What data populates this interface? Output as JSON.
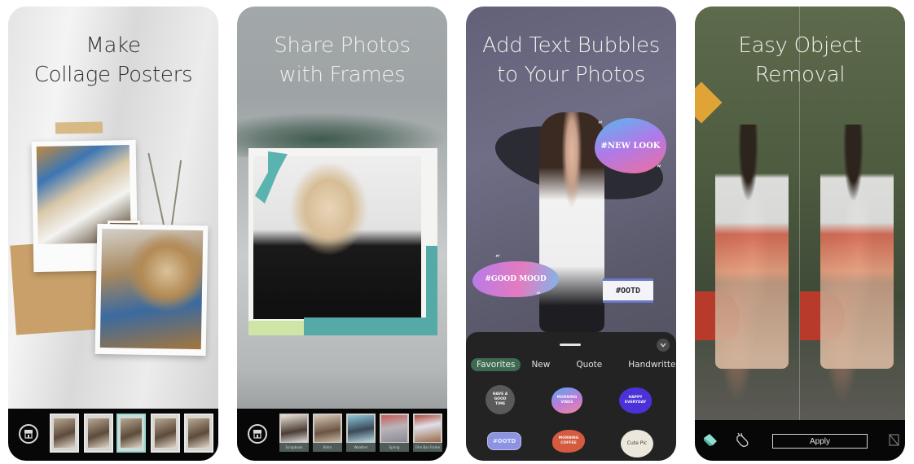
{
  "panels": [
    {
      "id": "collage",
      "headline_line1": "Make",
      "headline_line2": "Collage Posters",
      "thumbnails": [
        "Collage template 1",
        "Collage template 2",
        "Collage template 3",
        "Collage template 4",
        "Collage template 5"
      ],
      "selected_thumbnail_index": 2
    },
    {
      "id": "frames",
      "headline_line1": "Share Photos",
      "headline_line2": "with Frames",
      "frame_labels": [
        "Scrapbook",
        "Retro",
        "Weather",
        "Spring",
        "Film Bar Frame"
      ]
    },
    {
      "id": "text-bubbles",
      "headline_line1": "Add Text Bubbles",
      "headline_line2": "to Your Photos",
      "overlay_bubbles": [
        "#NEW LOOK",
        "#GOOD MOOD",
        "#OOTD"
      ],
      "tabs": [
        "Favorites",
        "New",
        "Quote",
        "Handwritten"
      ],
      "active_tab": "Favorites",
      "stickers": [
        {
          "text": "HAVE A GOOD TIME",
          "color": "#5a5a5a"
        },
        {
          "text": "MORNING VIBES",
          "color": "#b07ad8"
        },
        {
          "text": "HAPPY EVERYDAY",
          "color": "#4a32d8"
        },
        {
          "text": "#OOTD",
          "color": "#8c93e0"
        },
        {
          "text": "MORNING COFFEE",
          "color": "#d65a3e"
        },
        {
          "text": "Cute Pic",
          "color": "#ece7dc"
        }
      ]
    },
    {
      "id": "object-removal",
      "headline_line1": "Easy Object",
      "headline_line2": "Removal",
      "apply_label": "Apply"
    }
  ],
  "colors": {
    "accent_green": "#3f6a52",
    "selected_thumb": "#9fd6cf",
    "bar_black": "#070707"
  }
}
